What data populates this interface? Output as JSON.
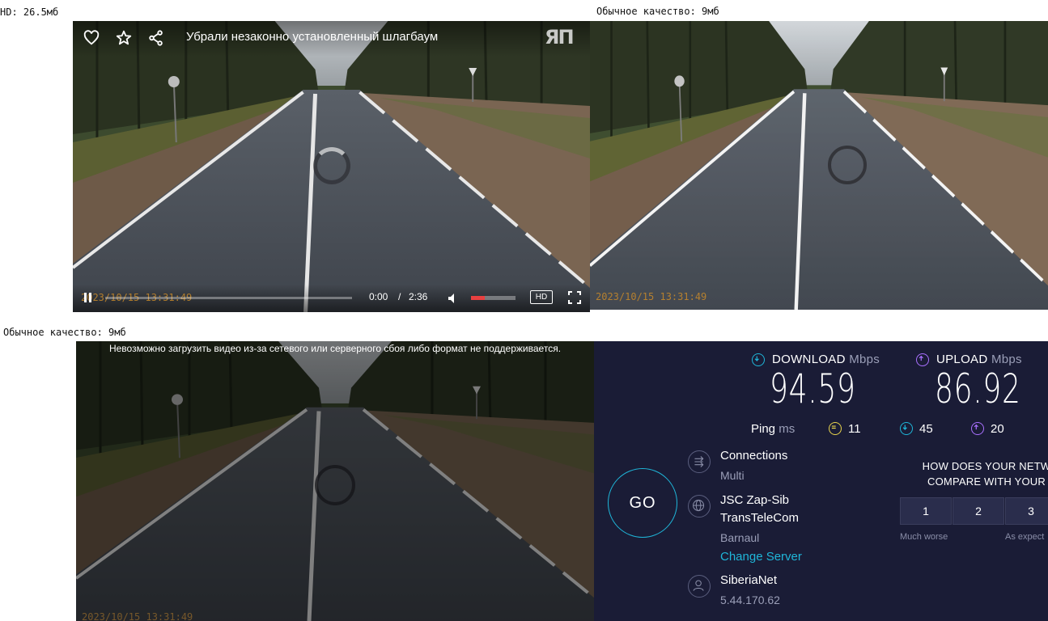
{
  "captions": {
    "hd": "HD: 26.5мб",
    "normal_top": "Обычное качество: 9мб",
    "normal_bottom": "Обычное качество: 9мб"
  },
  "player_hd": {
    "title": "Убрали незаконно установленный шлагбаум",
    "logo_text": "ЯП",
    "timestamp": "2023/10/15  13:31:49",
    "current_time": "0:00",
    "separator": "/",
    "duration": "2:36",
    "quality_badge": "HD",
    "volume_level": 0.3,
    "progress": 0.0,
    "icons": [
      "heart-icon",
      "star-icon",
      "share-icon",
      "play-pause-icon",
      "volume-icon",
      "fullscreen-icon"
    ]
  },
  "player_normal_top": {
    "timestamp": "2023/10/15  13:31:49"
  },
  "player_normal_bottom": {
    "error_message": "Невозможно загрузить видео из-за сетевого или серверного сбоя либо формат не поддерживается.",
    "timestamp": "2023/10/15  13:31:49"
  },
  "speedtest": {
    "download_label": "DOWNLOAD",
    "download_unit": "Mbps",
    "download_value": "94.59",
    "upload_label": "UPLOAD",
    "upload_unit": "Mbps",
    "upload_value": "86.92",
    "ping_label": "Ping",
    "ping_unit": "ms",
    "ping_idle": "11",
    "ping_download": "45",
    "ping_upload": "20",
    "go_label": "GO",
    "connections_label": "Connections",
    "connections_value": "Multi",
    "isp_line1": "JSC Zap-Sib",
    "isp_line2": "TransTeleCom",
    "isp_city": "Barnaul",
    "change_server": "Change Server",
    "host_name": "SiberiaNet",
    "host_ip": "5.44.170.62",
    "question_line1": "HOW DOES YOUR NETW",
    "question_line2": "COMPARE WITH YOUR",
    "rating_options": [
      "1",
      "2",
      "3"
    ],
    "rating_low_label": "Much worse",
    "rating_mid_label": "As expect",
    "colors": {
      "background": "#1a1c36",
      "cyan": "#1fb6d9",
      "purple": "#a970ff",
      "yellow": "#e8d44d"
    }
  }
}
